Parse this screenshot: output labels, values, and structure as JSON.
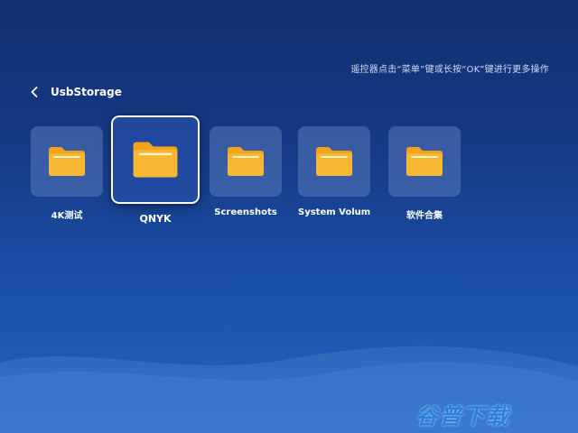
{
  "hint": "遥控器点击“菜单”键或长按“OK”键进行更多操作",
  "breadcrumb": {
    "title": "UsbStorage"
  },
  "folders": [
    {
      "name": "4K测试"
    },
    {
      "name": "QNYK"
    },
    {
      "name": "Screenshots"
    },
    {
      "name": "System Volume Ir"
    },
    {
      "name": "软件合集"
    }
  ],
  "watermark": "谷普下载",
  "colors": {
    "folder_body": "#f7b733",
    "folder_tab": "#f3a21c",
    "folder_stripe": "#fff3c8"
  }
}
